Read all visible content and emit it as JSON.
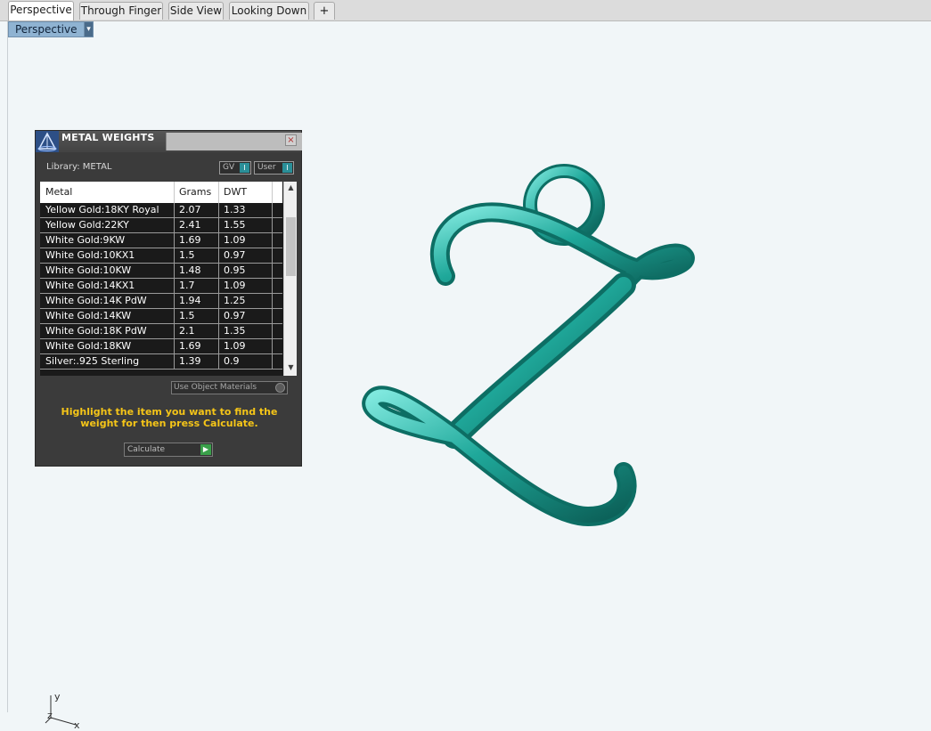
{
  "tabs": [
    {
      "label": "Perspective",
      "active": true
    },
    {
      "label": "Through Finger",
      "active": false
    },
    {
      "label": "Side View",
      "active": false
    },
    {
      "label": "Looking Down",
      "active": false
    }
  ],
  "add_tab_glyph": "+",
  "viewport": {
    "label": "Perspective",
    "dropdown_glyph": "▾",
    "axes": {
      "x": "x",
      "y": "y",
      "z": "z"
    }
  },
  "panel": {
    "title": "METAL WEIGHTS",
    "close_glyph": "×",
    "library": "Library: METAL",
    "toggles": [
      {
        "label": "GV",
        "knob": "I"
      },
      {
        "label": "User",
        "knob": "I"
      }
    ],
    "columns": [
      "Metal",
      "Grams",
      "DWT"
    ],
    "rows": [
      {
        "metal": "Yellow Gold:18KY Royal",
        "grams": "2.07",
        "dwt": "1.33"
      },
      {
        "metal": "Yellow Gold:22KY",
        "grams": "2.41",
        "dwt": "1.55"
      },
      {
        "metal": "White Gold:9KW",
        "grams": "1.69",
        "dwt": "1.09"
      },
      {
        "metal": "White Gold:10KX1",
        "grams": "1.5",
        "dwt": "0.97"
      },
      {
        "metal": "White Gold:10KW",
        "grams": "1.48",
        "dwt": "0.95"
      },
      {
        "metal": "White Gold:14KX1",
        "grams": "1.7",
        "dwt": "1.09"
      },
      {
        "metal": "White Gold:14K PdW",
        "grams": "1.94",
        "dwt": "1.25"
      },
      {
        "metal": "White Gold:14KW",
        "grams": "1.5",
        "dwt": "0.97"
      },
      {
        "metal": "White Gold:18K PdW",
        "grams": "2.1",
        "dwt": "1.35"
      },
      {
        "metal": "White Gold:18KW",
        "grams": "1.69",
        "dwt": "1.09"
      },
      {
        "metal": "Silver:.925 Sterling",
        "grams": "1.39",
        "dwt": "0.9"
      }
    ],
    "scroll_up": "▲",
    "scroll_down": "▼",
    "object_materials_label": "Use Object Materials",
    "hint": "Highlight the item you want to find the weight for then press Calculate.",
    "calculate_label": "Calculate",
    "calculate_glyph": "▶"
  },
  "colors": {
    "model": "#1fa89a",
    "hint": "#f5c518",
    "viewport_label": "#8fb3d2"
  }
}
